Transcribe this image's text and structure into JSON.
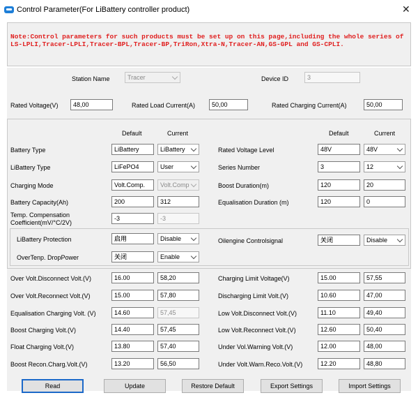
{
  "window": {
    "title": "Control Parameter(For LiBattery controller product)",
    "close_glyph": "✕"
  },
  "note": "Note:Control parameters for such products must be set up on this page,including the whole series of LS-LPLI,Tracer-LPLI,Tracer-BPL,Tracer-BP,TriRon,Xtra-N,Tracer-AN,GS-GPL and GS-CPLI.",
  "station": {
    "label": "Station Name",
    "value": "Tracer"
  },
  "device": {
    "label": "Device ID",
    "value": "3"
  },
  "rated": [
    {
      "label": "Rated Voltage(V)",
      "value": "48,00"
    },
    {
      "label": "Rated Load Current(A)",
      "value": "50,00"
    },
    {
      "label": "Rated Charging Current(A)",
      "value": "50,00"
    }
  ],
  "headers": {
    "default": "Default",
    "current": "Current"
  },
  "settings_left": [
    {
      "label": "Battery Type",
      "default": "LiBattery",
      "current": "LiBattery"
    },
    {
      "label": "LiBattery Type",
      "default": "LiFePO4",
      "current": "User"
    },
    {
      "label": "Charging Mode",
      "default": "Volt.Comp.",
      "current": "Volt.Comp"
    },
    {
      "label": "Battery Capacity(Ah)",
      "default": "200",
      "current": "312"
    },
    {
      "label": "Temp. Compensation Coefficient(mV/°C/2V)",
      "default": "-3",
      "current": "-3"
    }
  ],
  "settings_right": [
    {
      "label": "Rated Voltage Level",
      "default": "48V",
      "current": "48V"
    },
    {
      "label": "Series Number",
      "default": "3",
      "current": "12"
    },
    {
      "label": "Boost Duration(m)",
      "default": "120",
      "current": "20"
    },
    {
      "label": "Equalisation Duration (m)",
      "default": "120",
      "current": "0"
    }
  ],
  "protection": [
    {
      "label": "LiBattery Protection",
      "default": "启用",
      "current": "Disable"
    },
    {
      "label": "OverTenp. DropPower",
      "default": "关闭",
      "current": "Enable"
    },
    {
      "label": "Oilengine Controlsignal",
      "default": "关闭",
      "current": "Disable"
    }
  ],
  "volts_left": [
    {
      "label": "Over Volt.Disconnect Volt.(V)",
      "default": "16.00",
      "current": "58,20"
    },
    {
      "label": "Over Volt.Reconnect Volt.(V)",
      "default": "15.00",
      "current": "57,80"
    },
    {
      "label": "Equalisation Charging Volt. (V)",
      "default": "14.60",
      "current": "57,45"
    },
    {
      "label": "Boost Charging Volt.(V)",
      "default": "14.40",
      "current": "57,45"
    },
    {
      "label": "Float Charging Volt.(V)",
      "default": "13.80",
      "current": "57,40"
    },
    {
      "label": "Boost Recon.Charg.Volt.(V)",
      "default": "13.20",
      "current": "56,50"
    }
  ],
  "volts_right": [
    {
      "label": "Charging Limit Voltage(V)",
      "default": "15.00",
      "current": "57,55"
    },
    {
      "label": "Discharging Limit Volt.(V)",
      "default": "10.60",
      "current": "47,00"
    },
    {
      "label": "Low Volt.Disconnect Volt.(V)",
      "default": "11.10",
      "current": "49,40"
    },
    {
      "label": "Low Volt.Reconnect Volt.(V)",
      "default": "12.60",
      "current": "50,40"
    },
    {
      "label": "Under Vol.Warning Volt.(V)",
      "default": "12.00",
      "current": "48,00"
    },
    {
      "label": "Under Volt.Warn.Reco.Volt.(V)",
      "default": "12.20",
      "current": "48,80"
    }
  ],
  "buttons": [
    "Read",
    "Update",
    "Restore Default",
    "Export Settings",
    "Import Settings"
  ]
}
